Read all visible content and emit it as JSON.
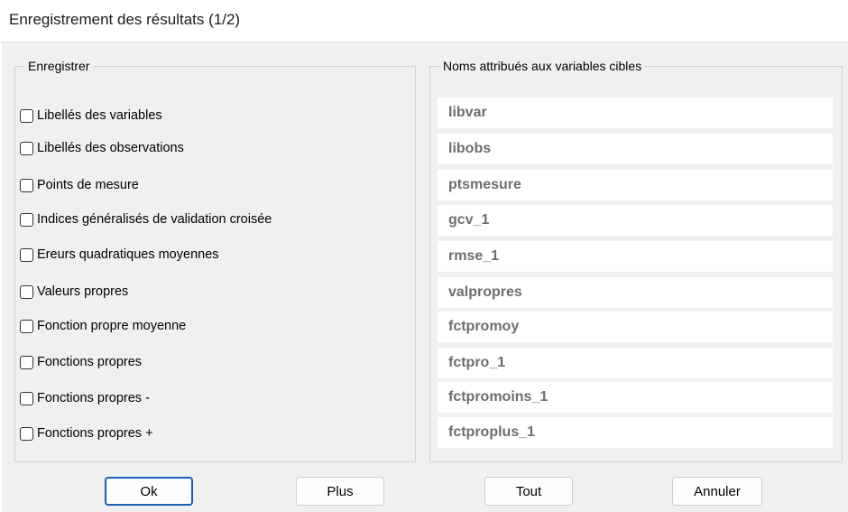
{
  "window": {
    "title": "Enregistrement des résultats (1/2)"
  },
  "groups": {
    "save_legend": "Enregistrer",
    "names_legend": "Noms attribués aux variables cibles"
  },
  "options": [
    {
      "label": "Libellés des variables",
      "checked": false
    },
    {
      "label": "Libellés des observations",
      "checked": false
    },
    {
      "label": "Points de mesure",
      "checked": false
    },
    {
      "label": "Indices généralisés de validation croisée",
      "checked": false
    },
    {
      "label": "Ereurs quadratiques moyennes",
      "checked": false
    },
    {
      "label": "Valeurs propres",
      "checked": false
    },
    {
      "label": "Fonction propre moyenne",
      "checked": false
    },
    {
      "label": "Fonctions propres",
      "checked": false
    },
    {
      "label": "Fonctions propres -",
      "checked": false
    },
    {
      "label": "Fonctions propres +",
      "checked": false
    }
  ],
  "names": [
    "libvar",
    "libobs",
    "ptsmesure",
    "gcv_1",
    "rmse_1",
    "valpropres",
    "fctpromoy",
    "fctpro_1",
    "fctpromoins_1",
    "fctproplus_1"
  ],
  "buttons": {
    "ok": "Ok",
    "plus": "Plus",
    "tout": "Tout",
    "annuler": "Annuler"
  }
}
